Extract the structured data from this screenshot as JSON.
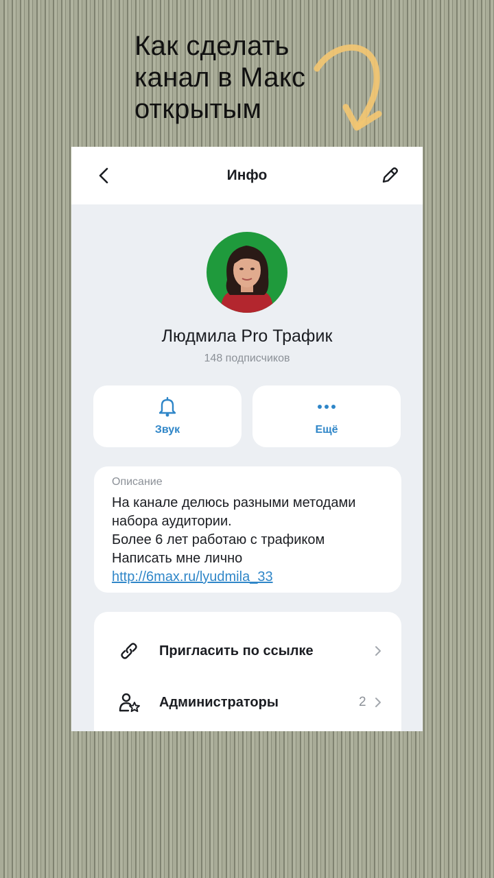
{
  "headline": "Как сделать\nканал в Макс\nоткрытым",
  "header": {
    "title": "Инфо",
    "back_icon": "chevron-left-icon",
    "edit_icon": "pencil-icon"
  },
  "channel": {
    "name": "Людмила Pro Трафик",
    "subscribers": "148 подписчиков"
  },
  "actions": [
    {
      "label": "Звук",
      "icon": "bell-icon"
    },
    {
      "label": "Ещё",
      "icon": "more-dots-icon"
    }
  ],
  "description": {
    "label": "Описание",
    "lines": [
      "На канале делюсь разными методами",
      "набора аудитории.",
      "Более 6 лет работаю с трафиком",
      "Написать мне лично"
    ],
    "link": "http://6max.ru/lyudmila_33"
  },
  "menu": [
    {
      "label": "Пригласить по ссылке",
      "icon": "link-icon",
      "count": ""
    },
    {
      "label": "Администраторы",
      "icon": "admins-icon",
      "count": "2"
    }
  ],
  "colors": {
    "accent": "#2f86c8",
    "background_stripes": "#a4a793",
    "arrow": "#f2c572",
    "avatar_bg": "#1f9a3c"
  }
}
